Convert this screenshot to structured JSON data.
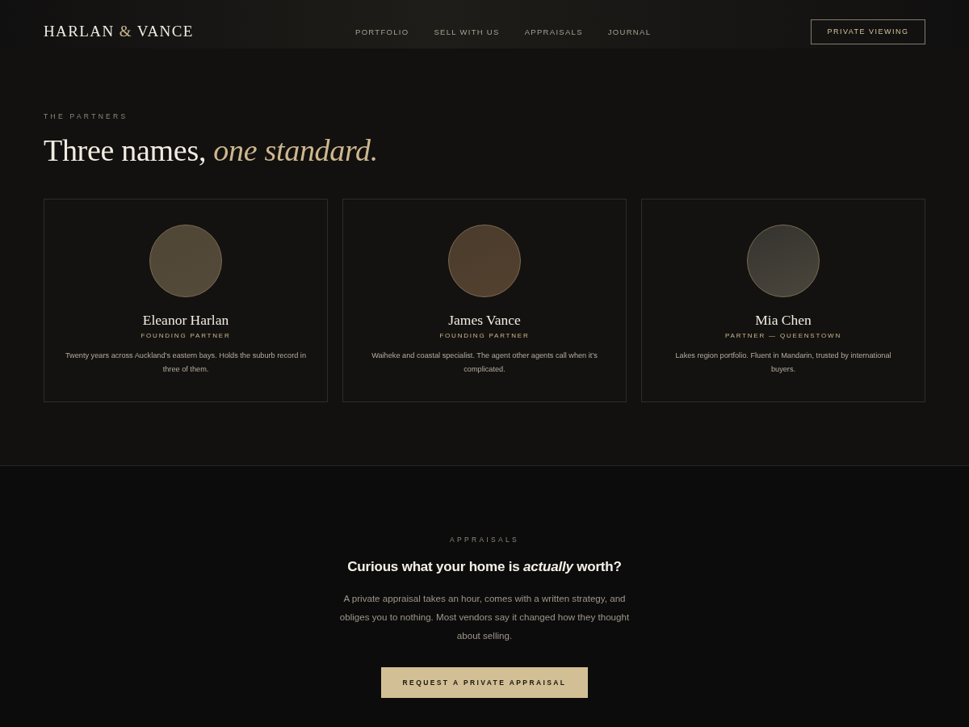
{
  "header": {
    "logo": [
      {
        "text": "HARLAN",
        "accent": false
      },
      {
        "text": "&",
        "accent": true
      },
      {
        "text": "VANCE",
        "accent": false
      }
    ],
    "nav": [
      "PORTFOLIO",
      "SELL WITH US",
      "APPRAISALS",
      "JOURNAL"
    ],
    "cta": "PRIVATE VIEWING"
  },
  "partners": {
    "eyebrow": "THE PARTNERS",
    "heading": "Three names, *one standard.*",
    "cards": [
      {
        "name": "Eleanor Harlan",
        "role": "FOUNDING PARTNER",
        "bio": "Twenty years across Auckland’s eastern bays. Holds the suburb record in three of them."
      },
      {
        "name": "James Vance",
        "role": "FOUNDING PARTNER",
        "bio": "Waiheke and coastal specialist. The agent other agents call when it’s complicated."
      },
      {
        "name": "Mia Chen",
        "role": "PARTNER — QUEENSTOWN",
        "bio": "Lakes region portfolio. Fluent in Mandarin, trusted by international buyers."
      }
    ]
  },
  "appraisals": {
    "eyebrow": "APPRAISALS",
    "heading": "Curious what your home is *actually* worth?",
    "body": "A private appraisal takes an hour, comes with a written strategy, and obliges you to nothing. Most vendors say it changed how they thought about selling.",
    "button": "REQUEST A PRIVATE APPRAISAL"
  }
}
